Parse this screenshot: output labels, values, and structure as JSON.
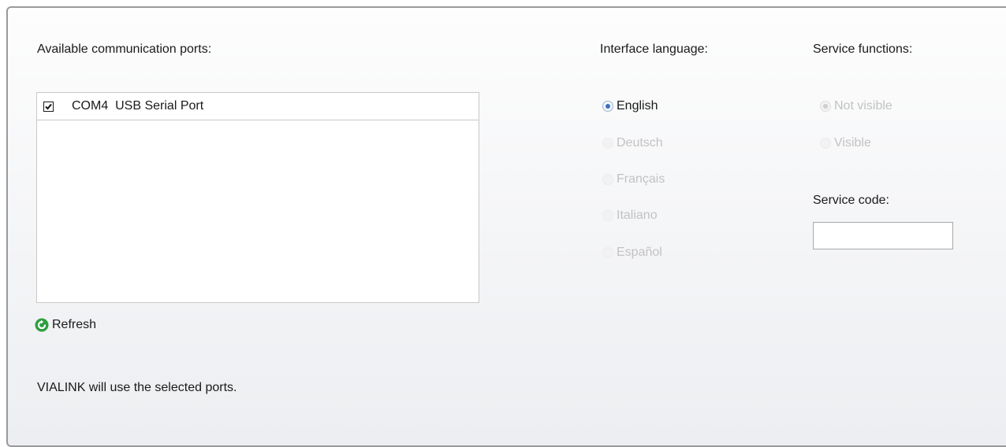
{
  "ports": {
    "label": "Available communication ports:",
    "items": [
      {
        "checked": true,
        "name": "COM4",
        "description": "USB Serial Port"
      }
    ],
    "refresh_label": "Refresh",
    "footnote": "VIALINK will use the selected ports."
  },
  "language": {
    "label": "Interface language:",
    "options": [
      {
        "label": "English",
        "selected": true,
        "enabled": true
      },
      {
        "label": "Deutsch",
        "selected": false,
        "enabled": false
      },
      {
        "label": "Français",
        "selected": false,
        "enabled": false
      },
      {
        "label": "Italiano",
        "selected": false,
        "enabled": false
      },
      {
        "label": "Español",
        "selected": false,
        "enabled": false
      }
    ]
  },
  "service": {
    "label": "Service functions:",
    "options": [
      {
        "label": "Not visible",
        "selected": true,
        "enabled": false
      },
      {
        "label": "Visible",
        "selected": false,
        "enabled": false
      }
    ],
    "code_label": "Service code:",
    "code_value": ""
  },
  "colors": {
    "accent": "#3b6fc6",
    "disabled_text": "#c2c2c2",
    "refresh_icon": "#2e9e3e"
  }
}
